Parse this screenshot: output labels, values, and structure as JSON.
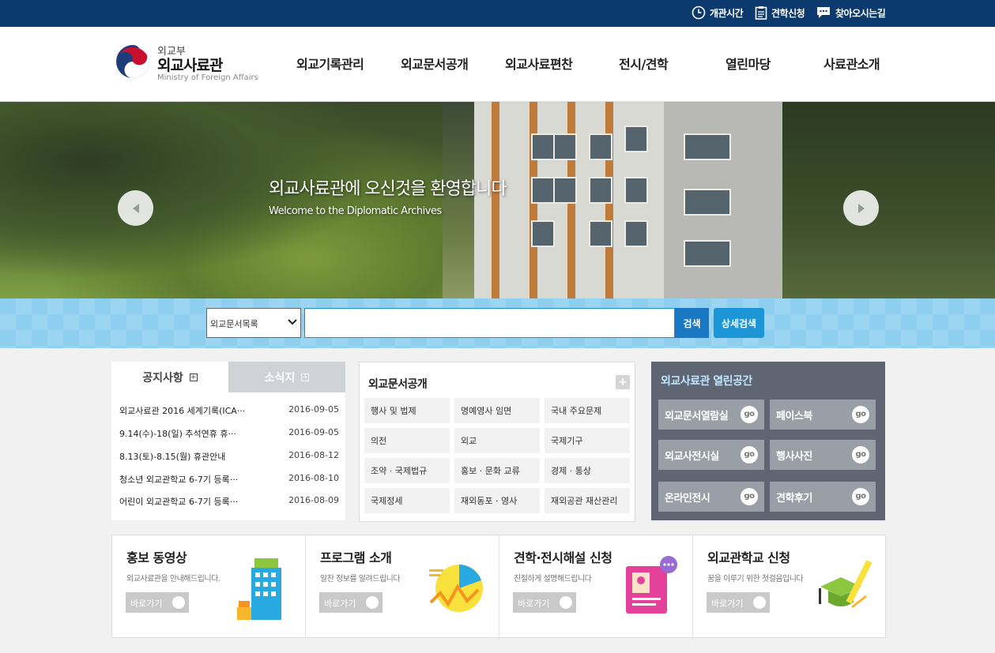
{
  "utility_nav": [
    {
      "label": "개관시간",
      "icon": "clock-icon"
    },
    {
      "label": "견학신청",
      "icon": "clipboard-icon"
    },
    {
      "label": "찾아오시는길",
      "icon": "chat-bubble-icon"
    }
  ],
  "logo": {
    "ministry": "외교부",
    "name": "외교사료관",
    "english": "Ministry of Foreign Affairs"
  },
  "main_nav": [
    "외교기록관리",
    "외교문서공개",
    "외교사료편찬",
    "전시/견학",
    "열린마당",
    "사료관소개"
  ],
  "hero": {
    "title": "외교사료관에 오신것을 환영합니다",
    "subtitle": "Welcome to the Diplomatic Archives"
  },
  "search": {
    "selected_option": "외교문서목록",
    "value": "",
    "button": "검색",
    "advanced_button": "상세검색"
  },
  "notice": {
    "tabs": [
      "공지사항",
      "소식지"
    ],
    "items": [
      {
        "title": "외교사료관 2016 세계기록(ICA···",
        "date": "2016-09-05"
      },
      {
        "title": "9.14(수)-18(일) 추석연휴 휴···",
        "date": "2016-09-05"
      },
      {
        "title": "8.13(토)-8.15(월) 휴관안내",
        "date": "2016-08-12"
      },
      {
        "title": "청소년 외교관학교 6-7기 등록···",
        "date": "2016-08-10"
      },
      {
        "title": "어린이 외교관학교 6-7기 등록···",
        "date": "2016-08-09"
      }
    ]
  },
  "documents": {
    "title": "외교문서공개",
    "more": "+",
    "cells": [
      "행사 및 법제",
      "명예영사 임면",
      "국내 주요문제",
      "의전",
      "외교",
      "국제기구",
      "조약 · 국제법규",
      "홍보 · 문화 교류",
      "경제 · 통상",
      "국제정세",
      "재외동포 · 영사",
      "재외공관 재산관리"
    ]
  },
  "open_space": {
    "title": "외교사료관 열린공간",
    "go": "go",
    "buttons": [
      "외교문서열람실",
      "페이스북",
      "외교사전시실",
      "행사사진",
      "온라인전시",
      "견학후기"
    ]
  },
  "banners": [
    {
      "title": "홍보 동영상",
      "desc": "외교사료관을 안내해드립니다.",
      "button": "바로가기"
    },
    {
      "title": "프로그램 소개",
      "desc": "알찬 정보를 알려드립니다",
      "button": "바로가기"
    },
    {
      "title": "견학·전시해설 신청",
      "desc": "친절하게 설명해드립니다",
      "button": "바로가기"
    },
    {
      "title": "외교관학교 신청",
      "desc": "꿈을 이루기 위한 첫걸음입니다",
      "button": "바로가기"
    }
  ],
  "colors": {
    "topbar": "#0d3a6e",
    "search_band": "#8ecff0",
    "search_button": "#1a78c2",
    "open_space_bg": "#5f6573"
  }
}
